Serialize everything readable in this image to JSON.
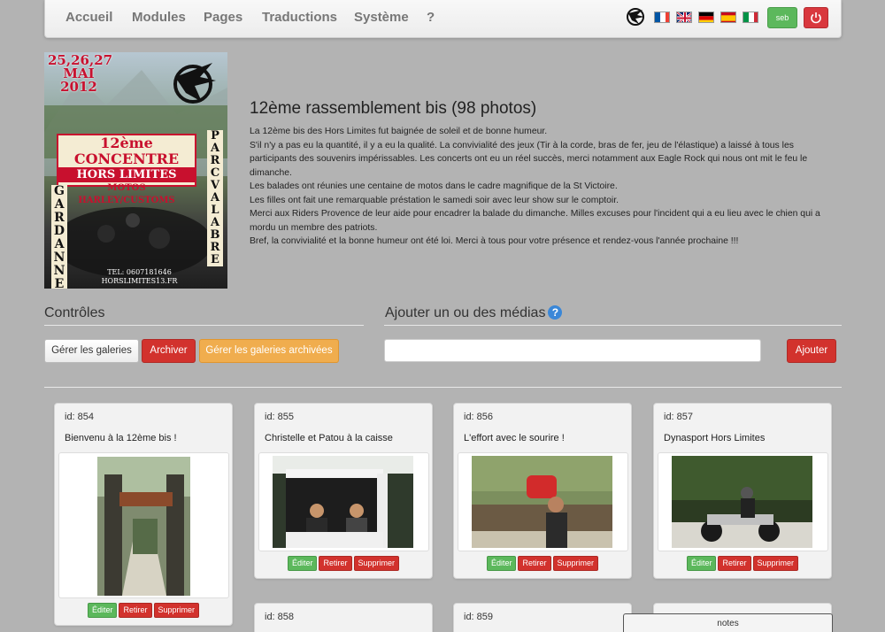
{
  "nav": {
    "items": [
      "Accueil",
      "Modules",
      "Pages",
      "Traductions",
      "Système",
      "?"
    ],
    "flags": [
      "fr",
      "en",
      "de",
      "es",
      "it"
    ],
    "user_label": "seb",
    "power_icon": "power-icon",
    "logo_icon": "eagle-logo-icon"
  },
  "poster": {
    "dates": "25,26,27",
    "month": "MAI",
    "year": "2012",
    "line1": "12ème CONCENTRE",
    "line2": "HORS LIMITES",
    "line3": "MOTOS HARLEY/CUSTOMS",
    "left_vertical": "GARDANNE",
    "right_vertical": "PARC VALABRE",
    "phone": "TEL: 0607181646",
    "site": "HORSLIMITES13.FR"
  },
  "album": {
    "title": "12ème rassemblement bis (98 photos)",
    "paragraphs": [
      "La 12ème bis des Hors Limites fut baignée de soleil et de bonne humeur.",
      "S'il n'y a pas eu la quantité, il y a eu la qualité. La convivialité des jeux (Tir à la corde, bras de fer, jeu de l'élastique) a laissé à tous les participants des souvenirs impérissables. Les concerts ont eu un réel succès, merci notamment aux Eagle Rock qui nous ont mit le feu le dimanche.",
      "Les balades ont réunies une centaine de motos dans le cadre magnifique de la St Victoire.",
      "Les filles ont fait une remarquable préstation le samedi soir avec leur show sur le comptoir.",
      "Merci aux Riders Provence de leur aide pour encadrer la balade du dimanche. Milles excuses pour l'incident qui a eu lieu avec le chien qui a mordu un membre des patriots.",
      "Bref, la convivialité et la bonne humeur ont été loi. Merci à tous pour votre présence et rendez-vous l'année prochaine !!!"
    ]
  },
  "controls": {
    "title": "Contrôles",
    "manage_galleries": "Gérer les galeries",
    "archive": "Archiver",
    "manage_archived": "Gérer les galeries archivées"
  },
  "media": {
    "title": "Ajouter un ou des médias",
    "help": "?",
    "input_value": "",
    "add": "Ajouter"
  },
  "cards": [
    {
      "id": "id: 854",
      "title": "Bienvenu à la 12ème bis !",
      "edit": "Éditer",
      "remove": "Retirer",
      "delete": "Supprimer"
    },
    {
      "id": "id: 855",
      "title": "Christelle et Patou à la caisse",
      "edit": "Éditer",
      "remove": "Retirer",
      "delete": "Supprimer"
    },
    {
      "id": "id: 856",
      "title": "L'effort avec le sourire !",
      "edit": "Éditer",
      "remove": "Retirer",
      "delete": "Supprimer"
    },
    {
      "id": "id: 857",
      "title": "Dynasport Hors Limites",
      "edit": "Éditer",
      "remove": "Retirer",
      "delete": "Supprimer"
    },
    {
      "id": "id: 858"
    },
    {
      "id": "id: 859"
    }
  ],
  "notes_label": "notes",
  "colors": {
    "background": "#b3b3b3",
    "danger": "#d2322d",
    "success": "#5cb85c",
    "warning": "#f0ad4e",
    "help": "#3a87d8"
  }
}
